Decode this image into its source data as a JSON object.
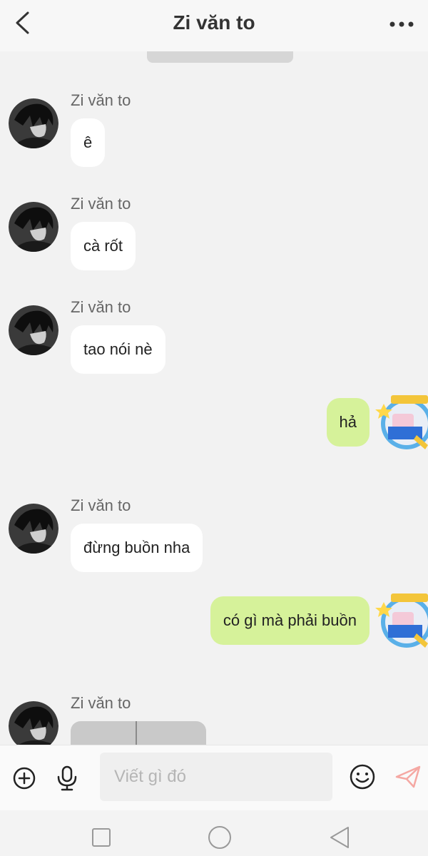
{
  "header": {
    "title": "Zi văn to",
    "back_icon": "chevron-left-icon",
    "more_icon": "more-horizontal-icon"
  },
  "messages": [
    {
      "sender": "Zi văn to",
      "text": "ê"
    },
    {
      "sender": "Zi văn to",
      "text": "cà rốt"
    },
    {
      "sender": "Zi văn to",
      "text": "tao nói nè"
    },
    {
      "text": "hả"
    },
    {
      "sender": "Zi văn to",
      "text": "đừng buồn nha"
    },
    {
      "text": "có gì mà phải buồn"
    },
    {
      "sender": "Zi văn to"
    }
  ],
  "composer": {
    "placeholder": "Viết gì đó",
    "plus_icon": "plus-circle-icon",
    "mic_icon": "microphone-icon",
    "emoji_icon": "emoji-icon",
    "send_icon": "send-icon"
  },
  "colors": {
    "incoming_bubble": "#ffffff",
    "outgoing_bubble": "#d6f29a",
    "background": "#f2f2f2"
  }
}
